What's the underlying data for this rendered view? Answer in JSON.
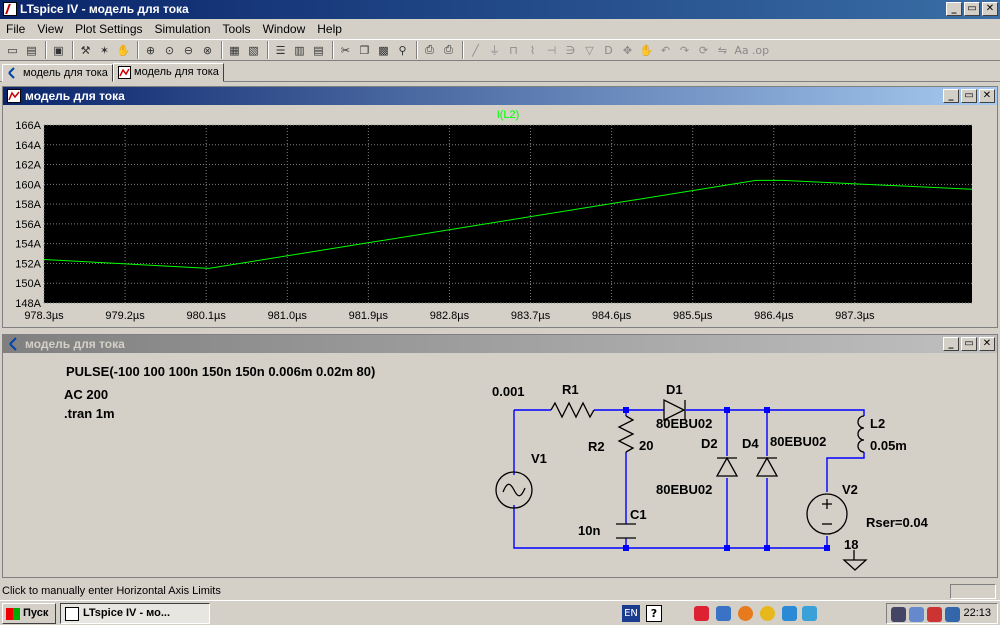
{
  "app": {
    "title": "LTspice IV - модель для тока",
    "menu": [
      "File",
      "View",
      "Plot Settings",
      "Simulation",
      "Tools",
      "Window",
      "Help"
    ],
    "window_buttons": [
      "_",
      "▭",
      "✕"
    ]
  },
  "tabs": [
    {
      "label": "модель для тока",
      "icon": "schematic-icon"
    },
    {
      "label": "модель для тока",
      "icon": "waveform-icon"
    }
  ],
  "plot_window": {
    "title": "модель для тока",
    "window_buttons": [
      "_",
      "▭",
      "✕"
    ]
  },
  "schematic_window": {
    "title": "модель для тока",
    "window_buttons": [
      "_",
      "▭",
      "✕"
    ]
  },
  "chart_data": {
    "type": "line",
    "series": [
      {
        "name": "I(L2)",
        "color": "#00ff00",
        "x": [
          978.3,
          980.13,
          986.2,
          986.5,
          988.6
        ],
        "y": [
          152.4,
          151.5,
          160.4,
          160.4,
          159.5
        ]
      }
    ],
    "x_ticks": [
      "978.3µs",
      "979.2µs",
      "980.1µs",
      "981.0µs",
      "981.9µs",
      "982.8µs",
      "983.7µs",
      "984.6µs",
      "985.5µs",
      "986.4µs",
      "987.3µs"
    ],
    "x_tick_values": [
      978.3,
      979.2,
      980.1,
      981.0,
      981.9,
      982.8,
      983.7,
      984.6,
      985.5,
      986.4,
      987.3
    ],
    "xlim": [
      978.3,
      988.6
    ],
    "y_ticks": [
      "166A",
      "164A",
      "162A",
      "160A",
      "158A",
      "156A",
      "154A",
      "152A",
      "150A",
      "148A"
    ],
    "y_tick_values": [
      166,
      164,
      162,
      160,
      158,
      156,
      154,
      152,
      150,
      148
    ],
    "ylim": [
      148,
      166
    ],
    "grid": true,
    "background": "#000000",
    "grid_color": "#808080",
    "axis_text_color": "#000000"
  },
  "schematic": {
    "directives": {
      "pulse": "PULSE(-100 100 100n 150n 150n 0.006m 0.02m 80)",
      "ac": "AC 200",
      "tran": ".tran 1m"
    },
    "components": {
      "r1_name": "R1",
      "r1_value": "0.001",
      "r2_name": "R2",
      "r2_value": "20",
      "c1_name": "C1",
      "c1_value": "10n",
      "d1_name": "D1",
      "d1_model": "80EBU02",
      "d2_name": "D2",
      "d2_model": "80EBU02",
      "d4_name": "D4",
      "d4_model": "80EBU02",
      "v1_name": "V1",
      "v2_name": "V2",
      "v2_value": "18",
      "v2_rser": "Rser=0.04",
      "l2_name": "L2",
      "l2_value": "0.05m"
    },
    "wire_color": "#0000ff",
    "part_color": "#000000",
    "node_color": "#0000ff"
  },
  "status": {
    "text": "Click to manually enter Horizontal Axis Limits"
  },
  "taskbar": {
    "start_label": "Пуск",
    "task_label": "LTspice IV - мо...",
    "lang": "EN",
    "clock": "22:13"
  }
}
